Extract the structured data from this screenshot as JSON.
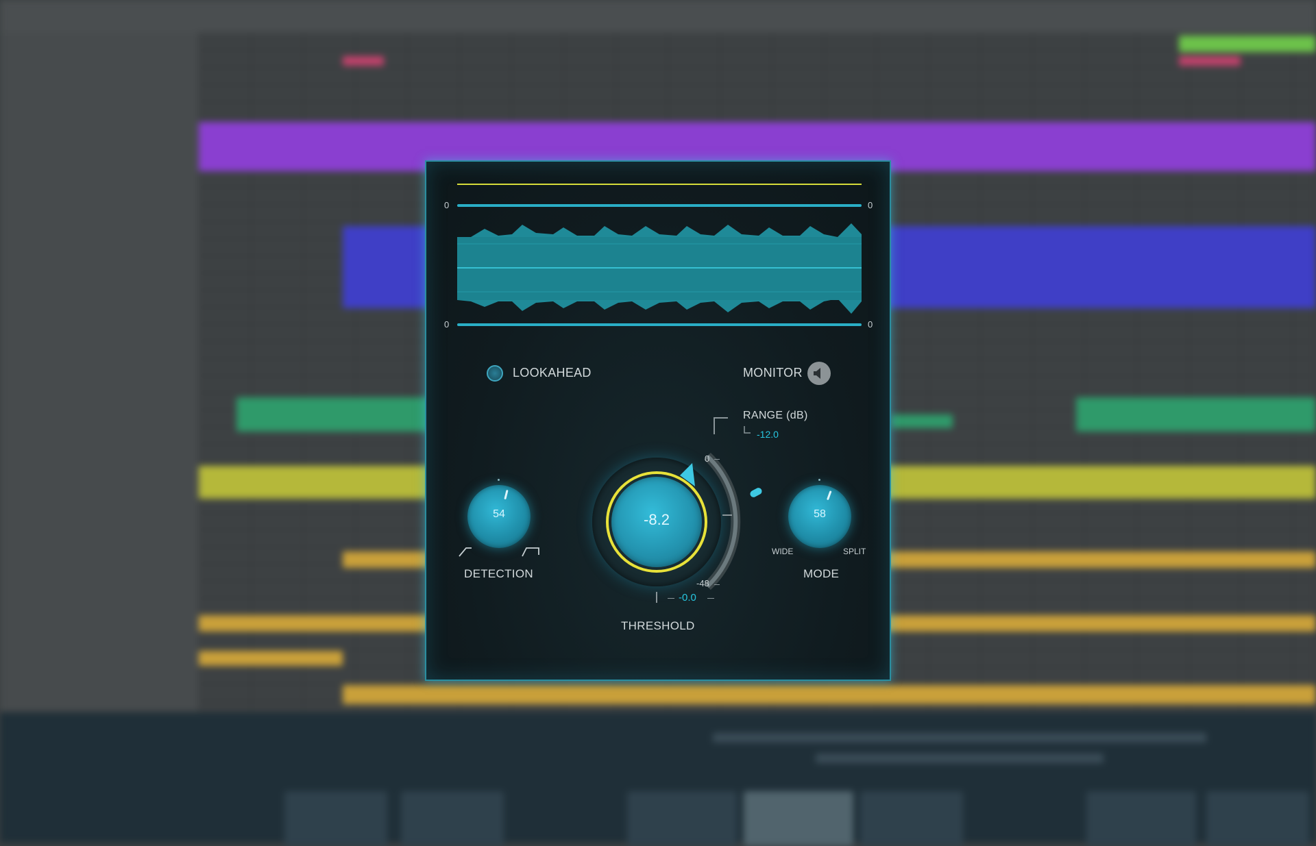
{
  "plugin": {
    "meter": {
      "top_left": "0",
      "top_right": "0",
      "bottom_left": "0",
      "bottom_right": "0"
    },
    "lookahead_label": "LOOKAHEAD",
    "lookahead_enabled": true,
    "monitor_label": "MONITOR",
    "range": {
      "label": "RANGE (dB)",
      "value": "-12.0"
    },
    "threshold": {
      "label": "THRESHOLD",
      "value": "-8.2",
      "scale_top": "0",
      "scale_bottom": "-48",
      "peak_readout": "-0.0"
    },
    "detection": {
      "label": "DETECTION",
      "value": "54"
    },
    "mode": {
      "label": "MODE",
      "value": "58",
      "left_label": "WIDE",
      "right_label": "SPLIT"
    }
  },
  "colors": {
    "accent": "#27c6e0",
    "threshold_ring": "#e8e23a",
    "panel_bg": "#101b1f"
  },
  "icons": {
    "monitor": "speaker-icon",
    "lookahead": "toggle-led-icon"
  }
}
